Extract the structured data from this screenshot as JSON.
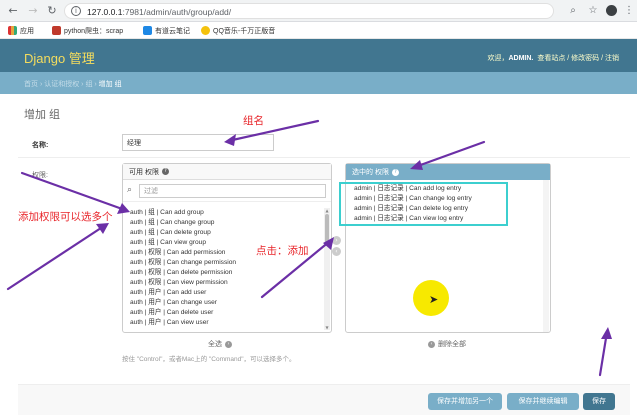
{
  "browser": {
    "url_host": "127.0.0.1",
    "url_path": ":7981/admin/auth/group/add/",
    "bookmarks": [
      "应用",
      "python爬虫：scrap",
      "有道云笔记",
      "QQ音乐-千万正版音"
    ]
  },
  "header": {
    "brand": "Django 管理",
    "welcome": "欢迎，",
    "user": "ADMIN.",
    "links": "查看站点 / 修改密码 / 注销"
  },
  "breadcrumb": {
    "trail": "首页 › 认证和授权 › 组 › ",
    "current": "增加 组"
  },
  "page": {
    "title": "增加 组"
  },
  "form": {
    "name_label": "名称:",
    "name_value": "经理",
    "perm_label": "权限:",
    "available_title": "可用 权限",
    "filter_placeholder": "过滤",
    "available_options": [
      "auth | 组 | Can add group",
      "auth | 组 | Can change group",
      "auth | 组 | Can delete group",
      "auth | 组 | Can view group",
      "auth | 权限 | Can add permission",
      "auth | 权限 | Can change permission",
      "auth | 权限 | Can delete permission",
      "auth | 权限 | Can view permission",
      "auth | 用户 | Can add user",
      "auth | 用户 | Can change user",
      "auth | 用户 | Can delete user",
      "auth | 用户 | Can view user"
    ],
    "chosen_title": "选中的 权限",
    "chosen_options": [
      "admin | 日志记录 | Can add log entry",
      "admin | 日志记录 | Can change log entry",
      "admin | 日志记录 | Can delete log entry",
      "admin | 日志记录 | Can view log entry"
    ],
    "choose_all": "全选",
    "remove_all": "删除全部",
    "help_text": "按住 \"Control\"，或者Mac上的 \"Command\"，可以选择多个。"
  },
  "buttons": {
    "save_add_another": "保存并增加另一个",
    "save_continue": "保存并继续编辑",
    "save": "保存"
  },
  "annotations": {
    "group_name": "组名",
    "add_multiple": "添加权限可以选多个",
    "click_add": "点击：添加"
  },
  "colors": {
    "header": "#417690",
    "breadcrumb": "#79aec8",
    "brand": "#f5dd5d",
    "annotation": "#e8262b",
    "arrow": "#6b2fa6",
    "highlight": "#3ccfcf"
  }
}
